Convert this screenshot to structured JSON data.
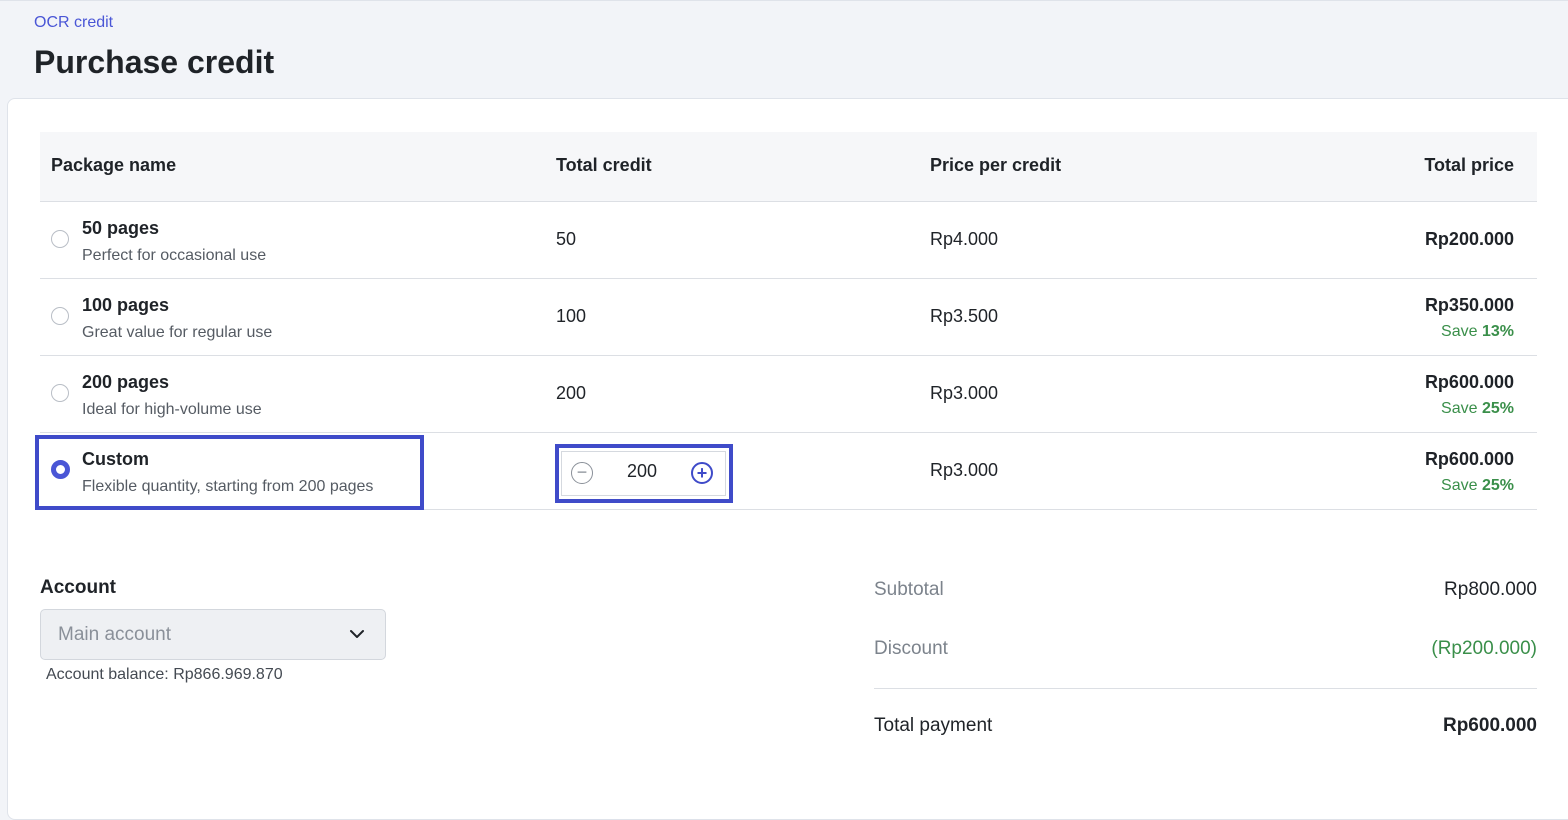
{
  "breadcrumb": "OCR credit",
  "title": "Purchase credit",
  "table": {
    "headers": {
      "package_name": "Package name",
      "total_credit": "Total credit",
      "price_per_credit": "Price per credit",
      "total_price": "Total price"
    },
    "rows": [
      {
        "name": "50 pages",
        "desc": "Perfect for occasional use",
        "credit": "50",
        "ppc": "Rp4.000",
        "price": "Rp200.000",
        "save_label": "",
        "save_pct": "",
        "selected": false
      },
      {
        "name": "100 pages",
        "desc": "Great value for regular use",
        "credit": "100",
        "ppc": "Rp3.500",
        "price": "Rp350.000",
        "save_label": "Save ",
        "save_pct": "13%",
        "selected": false
      },
      {
        "name": "200 pages",
        "desc": "Ideal for high-volume use",
        "credit": "200",
        "ppc": "Rp3.000",
        "price": "Rp600.000",
        "save_label": "Save ",
        "save_pct": "25%",
        "selected": false
      },
      {
        "name": "Custom",
        "desc": "Flexible quantity, starting from 200 pages",
        "credit": "200",
        "ppc": "Rp3.000",
        "price": "Rp600.000",
        "save_label": "Save ",
        "save_pct": "25%",
        "selected": true
      }
    ]
  },
  "stepper": {
    "minus": "−",
    "plus": "+",
    "value": "200"
  },
  "account": {
    "label": "Account",
    "selected": "Main account",
    "balance": "Account balance: Rp866.969.870"
  },
  "summary": {
    "subtotal_label": "Subtotal",
    "subtotal_value": "Rp800.000",
    "discount_label": "Discount",
    "discount_value": "(Rp200.000)",
    "total_label": "Total payment",
    "total_value": "Rp600.000"
  },
  "colors": {
    "accent": "#3f4bc9",
    "savings": "#3a8f4a"
  }
}
